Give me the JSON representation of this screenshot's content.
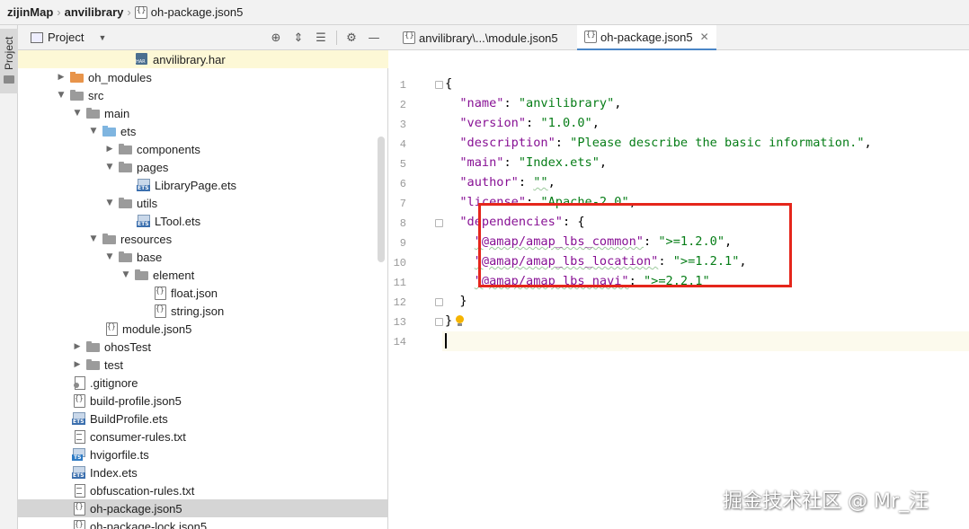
{
  "breadcrumb": {
    "items": [
      "zijinMap",
      "anvilibrary",
      "oh-package.json5"
    ]
  },
  "tool_strip": {
    "project_label": "Project"
  },
  "project_panel": {
    "title": "Project",
    "header_icons": [
      "target-icon",
      "expand-all-icon",
      "collapse-all-icon",
      "gear-icon",
      "minimize-icon"
    ]
  },
  "tree": {
    "items": [
      {
        "label": "anvilibrary.har",
        "icon": "har-file-icon"
      },
      {
        "label": "oh_modules",
        "icon": "folder-orange-icon"
      },
      {
        "label": "src",
        "icon": "folder-icon"
      },
      {
        "label": "main",
        "icon": "folder-icon"
      },
      {
        "label": "ets",
        "icon": "folder-blue-icon"
      },
      {
        "label": "components",
        "icon": "folder-icon"
      },
      {
        "label": "pages",
        "icon": "folder-icon"
      },
      {
        "label": "LibraryPage.ets",
        "icon": "ets-file-icon"
      },
      {
        "label": "utils",
        "icon": "folder-icon"
      },
      {
        "label": "LTool.ets",
        "icon": "ets-file-icon"
      },
      {
        "label": "resources",
        "icon": "folder-icon"
      },
      {
        "label": "base",
        "icon": "folder-icon"
      },
      {
        "label": "element",
        "icon": "folder-icon"
      },
      {
        "label": "float.json",
        "icon": "json-file-icon"
      },
      {
        "label": "string.json",
        "icon": "json-file-icon"
      },
      {
        "label": "module.json5",
        "icon": "json-file-icon"
      },
      {
        "label": "ohosTest",
        "icon": "folder-icon"
      },
      {
        "label": "test",
        "icon": "folder-icon"
      },
      {
        "label": ".gitignore",
        "icon": "gitignore-file-icon"
      },
      {
        "label": "build-profile.json5",
        "icon": "json-file-icon"
      },
      {
        "label": "BuildProfile.ets",
        "icon": "ets-file-icon"
      },
      {
        "label": "consumer-rules.txt",
        "icon": "text-file-icon"
      },
      {
        "label": "hvigorfile.ts",
        "icon": "ts-file-icon"
      },
      {
        "label": "Index.ets",
        "icon": "ets-file-icon"
      },
      {
        "label": "obfuscation-rules.txt",
        "icon": "text-file-icon"
      },
      {
        "label": "oh-package.json5",
        "icon": "json-file-icon"
      },
      {
        "label": "oh-package-lock.json5",
        "icon": "json-file-icon"
      }
    ]
  },
  "editor": {
    "tabs": [
      {
        "label": "anvilibrary\\...\\module.json5",
        "active": false
      },
      {
        "label": "oh-package.json5",
        "active": true
      }
    ],
    "line_numbers": [
      "1",
      "2",
      "3",
      "4",
      "5",
      "6",
      "7",
      "8",
      "9",
      "10",
      "11",
      "12",
      "13",
      "14"
    ],
    "code": {
      "l1": "{",
      "l2_key": "\"name\"",
      "l2_val": "\"anvilibrary\"",
      "l3_key": "\"version\"",
      "l3_val": "\"1.0.0\"",
      "l4_key": "\"description\"",
      "l4_val": "\"Please describe the basic information.\"",
      "l5_key": "\"main\"",
      "l5_val": "\"Index.ets\"",
      "l6_key": "\"author\"",
      "l6_val": "\"\"",
      "l7_key": "\"license\"",
      "l7_val": "\"Apache-2.0\"",
      "l8_key": "\"dependencies\"",
      "l9_key": "\"@amap/amap_lbs_common\"",
      "l9_val": "\">=1.2.0\"",
      "l10_key": "\"@amap/amap_lbs_location\"",
      "l10_val": "\">=1.2.1\"",
      "l11_key": "\"@amap/amap_lbs_navi\"",
      "l11_val": "\">=2.2.1\"",
      "l12": "}",
      "l13": "}"
    }
  },
  "watermark": "掘金技术社区 @ Mr_汪",
  "colors": {
    "key": "#871094",
    "string": "#067d17",
    "highlight_box": "#e5261b",
    "selected_row": "#d5d5d5"
  }
}
